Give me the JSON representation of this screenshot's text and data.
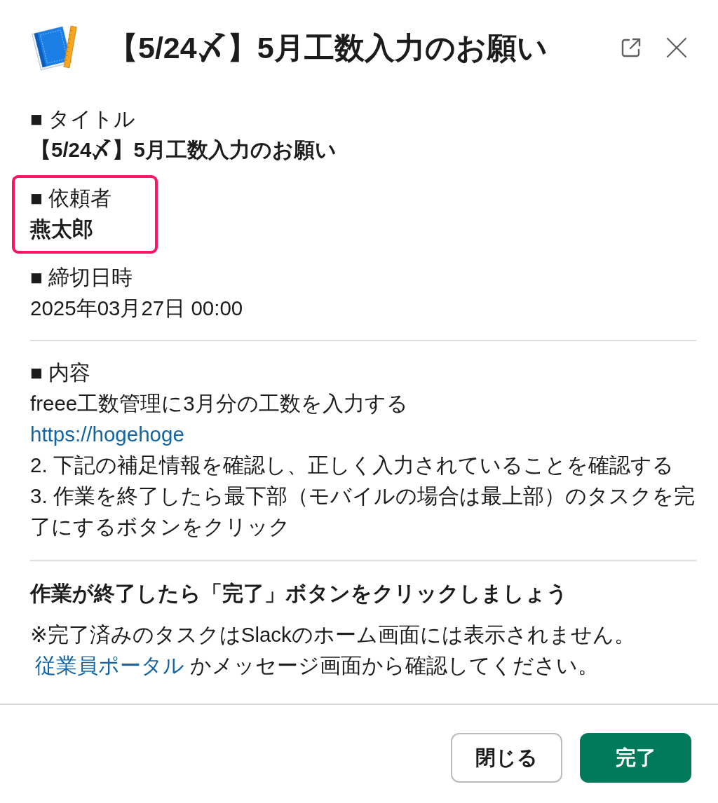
{
  "dialog": {
    "title": "【5/24〆】5月工数入力のお願い"
  },
  "sections": [
    {
      "label": "■ タイトル",
      "value": "【5/24〆】5月工数入力のお願い",
      "bold": true,
      "highlighted": false
    },
    {
      "label": "■ 依頼者",
      "value": "燕太郎",
      "bold": true,
      "highlighted": true
    },
    {
      "label": "■ 締切日時",
      "value": "2025年03月27日 00:00",
      "bold": false,
      "highlighted": false
    }
  ],
  "content": {
    "label": "■ 内容",
    "lines": [
      {
        "kind": "text",
        "text": "freee工数管理に3月分の工数を入力する"
      },
      {
        "kind": "link",
        "text": "https://hogehoge"
      },
      {
        "kind": "text",
        "text": "2. 下記の補足情報を確認し、正しく入力されていることを確認する"
      },
      {
        "kind": "text",
        "text": "3. 作業を終了したら最下部（モバイルの場合は最上部）のタスクを完了にするボタンをクリック"
      }
    ]
  },
  "completion": {
    "heading": "作業が終了したら「完了」ボタンをクリックしましょう",
    "note": "※完了済みのタスクはSlackのホーム画面には表示されません。",
    "link": "従業員ポータル",
    "note_end": "かメッセージ画面から確認してください。"
  },
  "buttons": [
    {
      "label": "閉じる",
      "kind": "secondary"
    },
    {
      "label": "完了",
      "kind": "primary"
    }
  ]
}
